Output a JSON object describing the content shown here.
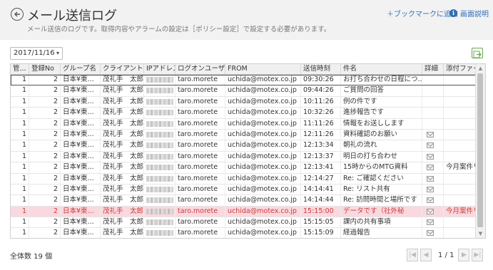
{
  "header": {
    "title": "メール送信ログ",
    "subtitle": "メール送信のログです。取得内容やアラームの設定は［ポリシー設定］で設定する必要があります。",
    "bookmark_label": "＋ブックマークに追加",
    "help_label": "画面説明",
    "back_icon": "arrow-left-circle-icon",
    "help_icon": "info-icon"
  },
  "toolbar": {
    "date_value": "2017/11/16",
    "date_chevron": "▾",
    "export_icon": "export-arrow-icon"
  },
  "table": {
    "columns": [
      "管...",
      "登録No",
      "グループ名",
      "クライアント名",
      "IPアドレス",
      "ログオンユーザ...",
      "FROM",
      "送信時刻",
      "件名",
      "詳細",
      "添付ファイル"
    ],
    "rows": [
      {
        "c0": "1",
        "c1": "2",
        "c2": "日本¥東...",
        "c3": "茂礼手　太郎",
        "c5": "taro.morete",
        "c6": "uchida@motex.co.jp",
        "c7": "09:30:26",
        "c8": "お打ち合わせの日程につ...",
        "detail": false,
        "c10": ""
      },
      {
        "c0": "1",
        "c1": "2",
        "c2": "日本¥東...",
        "c3": "茂礼手　太郎",
        "c5": "taro.morete",
        "c6": "uchida@motex.co.jp",
        "c7": "09:44:26",
        "c8": "ご質問の回答",
        "detail": false,
        "c10": ""
      },
      {
        "c0": "1",
        "c1": "2",
        "c2": "日本¥東...",
        "c3": "茂礼手　太郎",
        "c5": "taro.morete",
        "c6": "uchida@motex.co.jp",
        "c7": "10:11:26",
        "c8": "例の件です",
        "detail": false,
        "c10": ""
      },
      {
        "c0": "1",
        "c1": "2",
        "c2": "日本¥東...",
        "c3": "茂礼手　太郎",
        "c5": "taro.morete",
        "c6": "uchida@motex.co.jp",
        "c7": "10:32:26",
        "c8": "進捗報告です",
        "detail": false,
        "c10": ""
      },
      {
        "c0": "1",
        "c1": "2",
        "c2": "日本¥東...",
        "c3": "茂礼手　太郎",
        "c5": "taro.morete",
        "c6": "uchida@motex.co.jp",
        "c7": "11:11:26",
        "c8": "情報をお送しします",
        "detail": false,
        "c10": ""
      },
      {
        "c0": "1",
        "c1": "2",
        "c2": "日本¥東...",
        "c3": "茂礼手　太郎",
        "c5": "taro.morete",
        "c6": "uchida@motex.co.jp",
        "c7": "12:11:26",
        "c8": "資料確認のお願い",
        "detail": true,
        "c10": ""
      },
      {
        "c0": "1",
        "c1": "2",
        "c2": "日本¥東...",
        "c3": "茂礼手　太郎",
        "c5": "taro.morete",
        "c6": "uchida@motex.co.jp",
        "c7": "12:13:34",
        "c8": "朝礼の流れ",
        "detail": true,
        "c10": ""
      },
      {
        "c0": "1",
        "c1": "2",
        "c2": "日本¥東...",
        "c3": "茂礼手　太郎",
        "c5": "taro.morete",
        "c6": "uchida@motex.co.jp",
        "c7": "12:13:37",
        "c8": "明日の打ち合わせ",
        "detail": true,
        "c10": ""
      },
      {
        "c0": "1",
        "c1": "2",
        "c2": "日本¥東...",
        "c3": "茂礼手　太郎",
        "c5": "taro.morete",
        "c6": "uchida@motex.co.jp",
        "c7": "12:13:41",
        "c8": "15時からのMTG資料",
        "detail": true,
        "c10": "今月案件リ..."
      },
      {
        "c0": "1",
        "c1": "2",
        "c2": "日本¥東...",
        "c3": "茂礼手　太郎",
        "c5": "taro.morete",
        "c6": "uchida@motex.co.jp",
        "c7": "12:14:27",
        "c8": "Re: ご確認ください",
        "detail": true,
        "c10": ""
      },
      {
        "c0": "1",
        "c1": "2",
        "c2": "日本¥東...",
        "c3": "茂礼手　太郎",
        "c5": "taro.morete",
        "c6": "uchida@motex.co.jp",
        "c7": "14:14:41",
        "c8": "Re: リスト共有",
        "detail": true,
        "c10": ""
      },
      {
        "c0": "1",
        "c1": "2",
        "c2": "日本¥東...",
        "c3": "茂礼手　太郎",
        "c5": "taro.morete",
        "c6": "uchida@motex.co.jp",
        "c7": "14:14:44",
        "c8": "Re: 訪問時間と場所です",
        "detail": true,
        "c10": ""
      },
      {
        "c0": "1",
        "c1": "2",
        "c2": "日本¥東...",
        "c3": "茂礼手　太郎",
        "c5": "taro.morete",
        "c6": "uchida@motex.co.jp",
        "c7": "15:15:00",
        "c8": "データです（社外秘",
        "detail": true,
        "c10": "今月案件リ...",
        "alert": true
      },
      {
        "c0": "1",
        "c1": "2",
        "c2": "日本¥東...",
        "c3": "茂礼手　太郎",
        "c5": "taro.morete",
        "c6": "uchida@motex.co.jp",
        "c7": "15:15:05",
        "c8": "課内の共有事項",
        "detail": true,
        "c10": ""
      },
      {
        "c0": "1",
        "c1": "2",
        "c2": "日本¥東...",
        "c3": "茂礼手　太郎",
        "c5": "taro.morete",
        "c6": "uchida@motex.co.jp",
        "c7": "15:15:09",
        "c8": "経過報告",
        "detail": true,
        "c10": ""
      }
    ]
  },
  "footer": {
    "total_label": "全体数 19 個",
    "page_info": "1 / 1"
  },
  "colors": {
    "accent": "#2f6db5",
    "alert_row_bg": "#f9d9df",
    "alert_text": "#d03a3a"
  }
}
